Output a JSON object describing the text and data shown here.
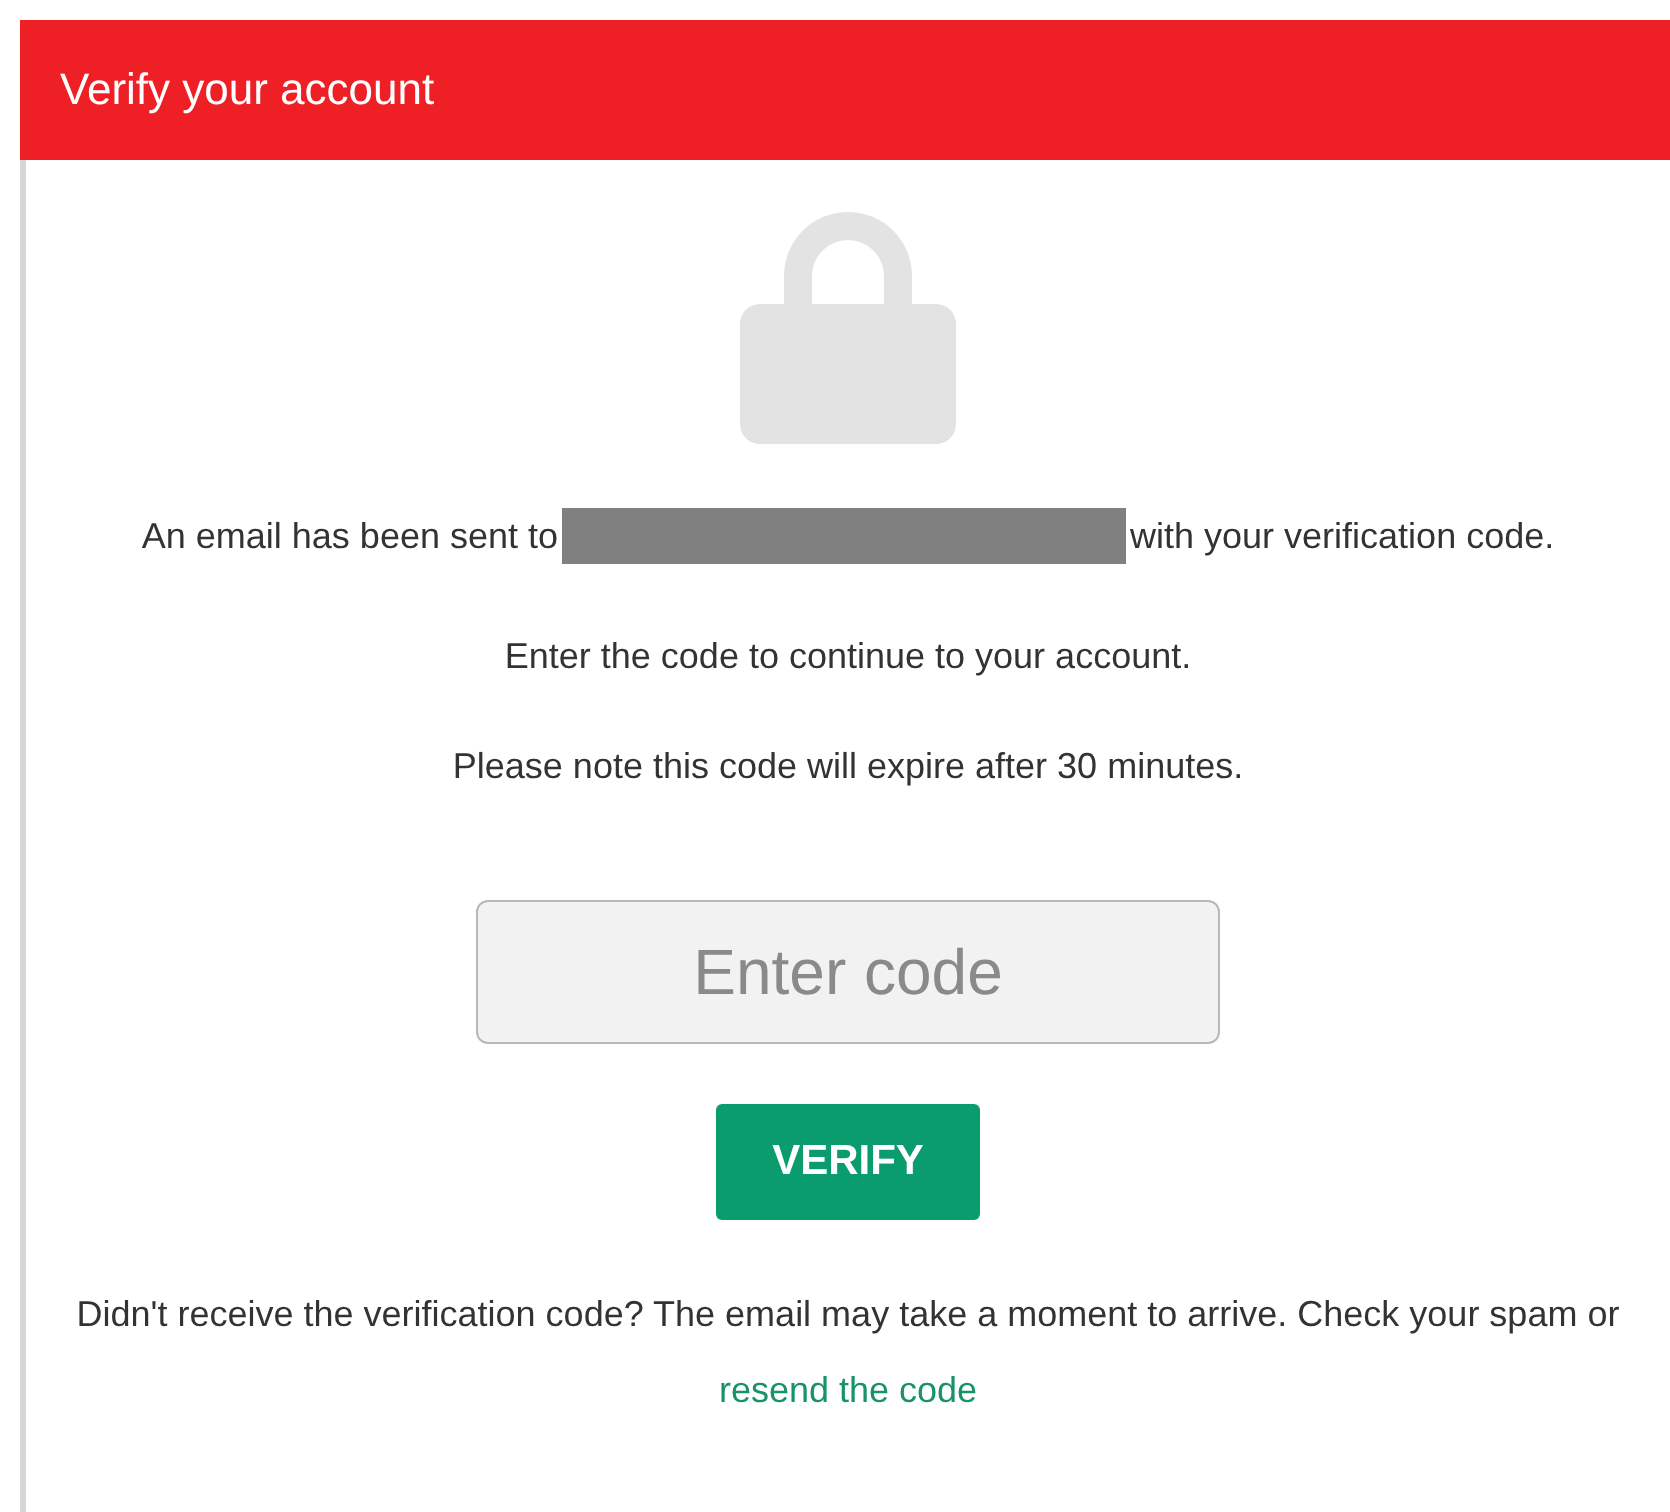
{
  "header": {
    "title": "Verify your account"
  },
  "message": {
    "before": "An email has been sent to",
    "after": "with your verification code."
  },
  "instructions": [
    "Enter the code to continue to your account.",
    "Please note this code will expire after 30 minutes."
  ],
  "code_field": {
    "placeholder": "Enter code"
  },
  "verify_button": {
    "label": "VERIFY"
  },
  "footer": {
    "text": "Didn't receive the verification code? The email may take a moment to arrive. Check your spam or",
    "link": "resend the code"
  }
}
